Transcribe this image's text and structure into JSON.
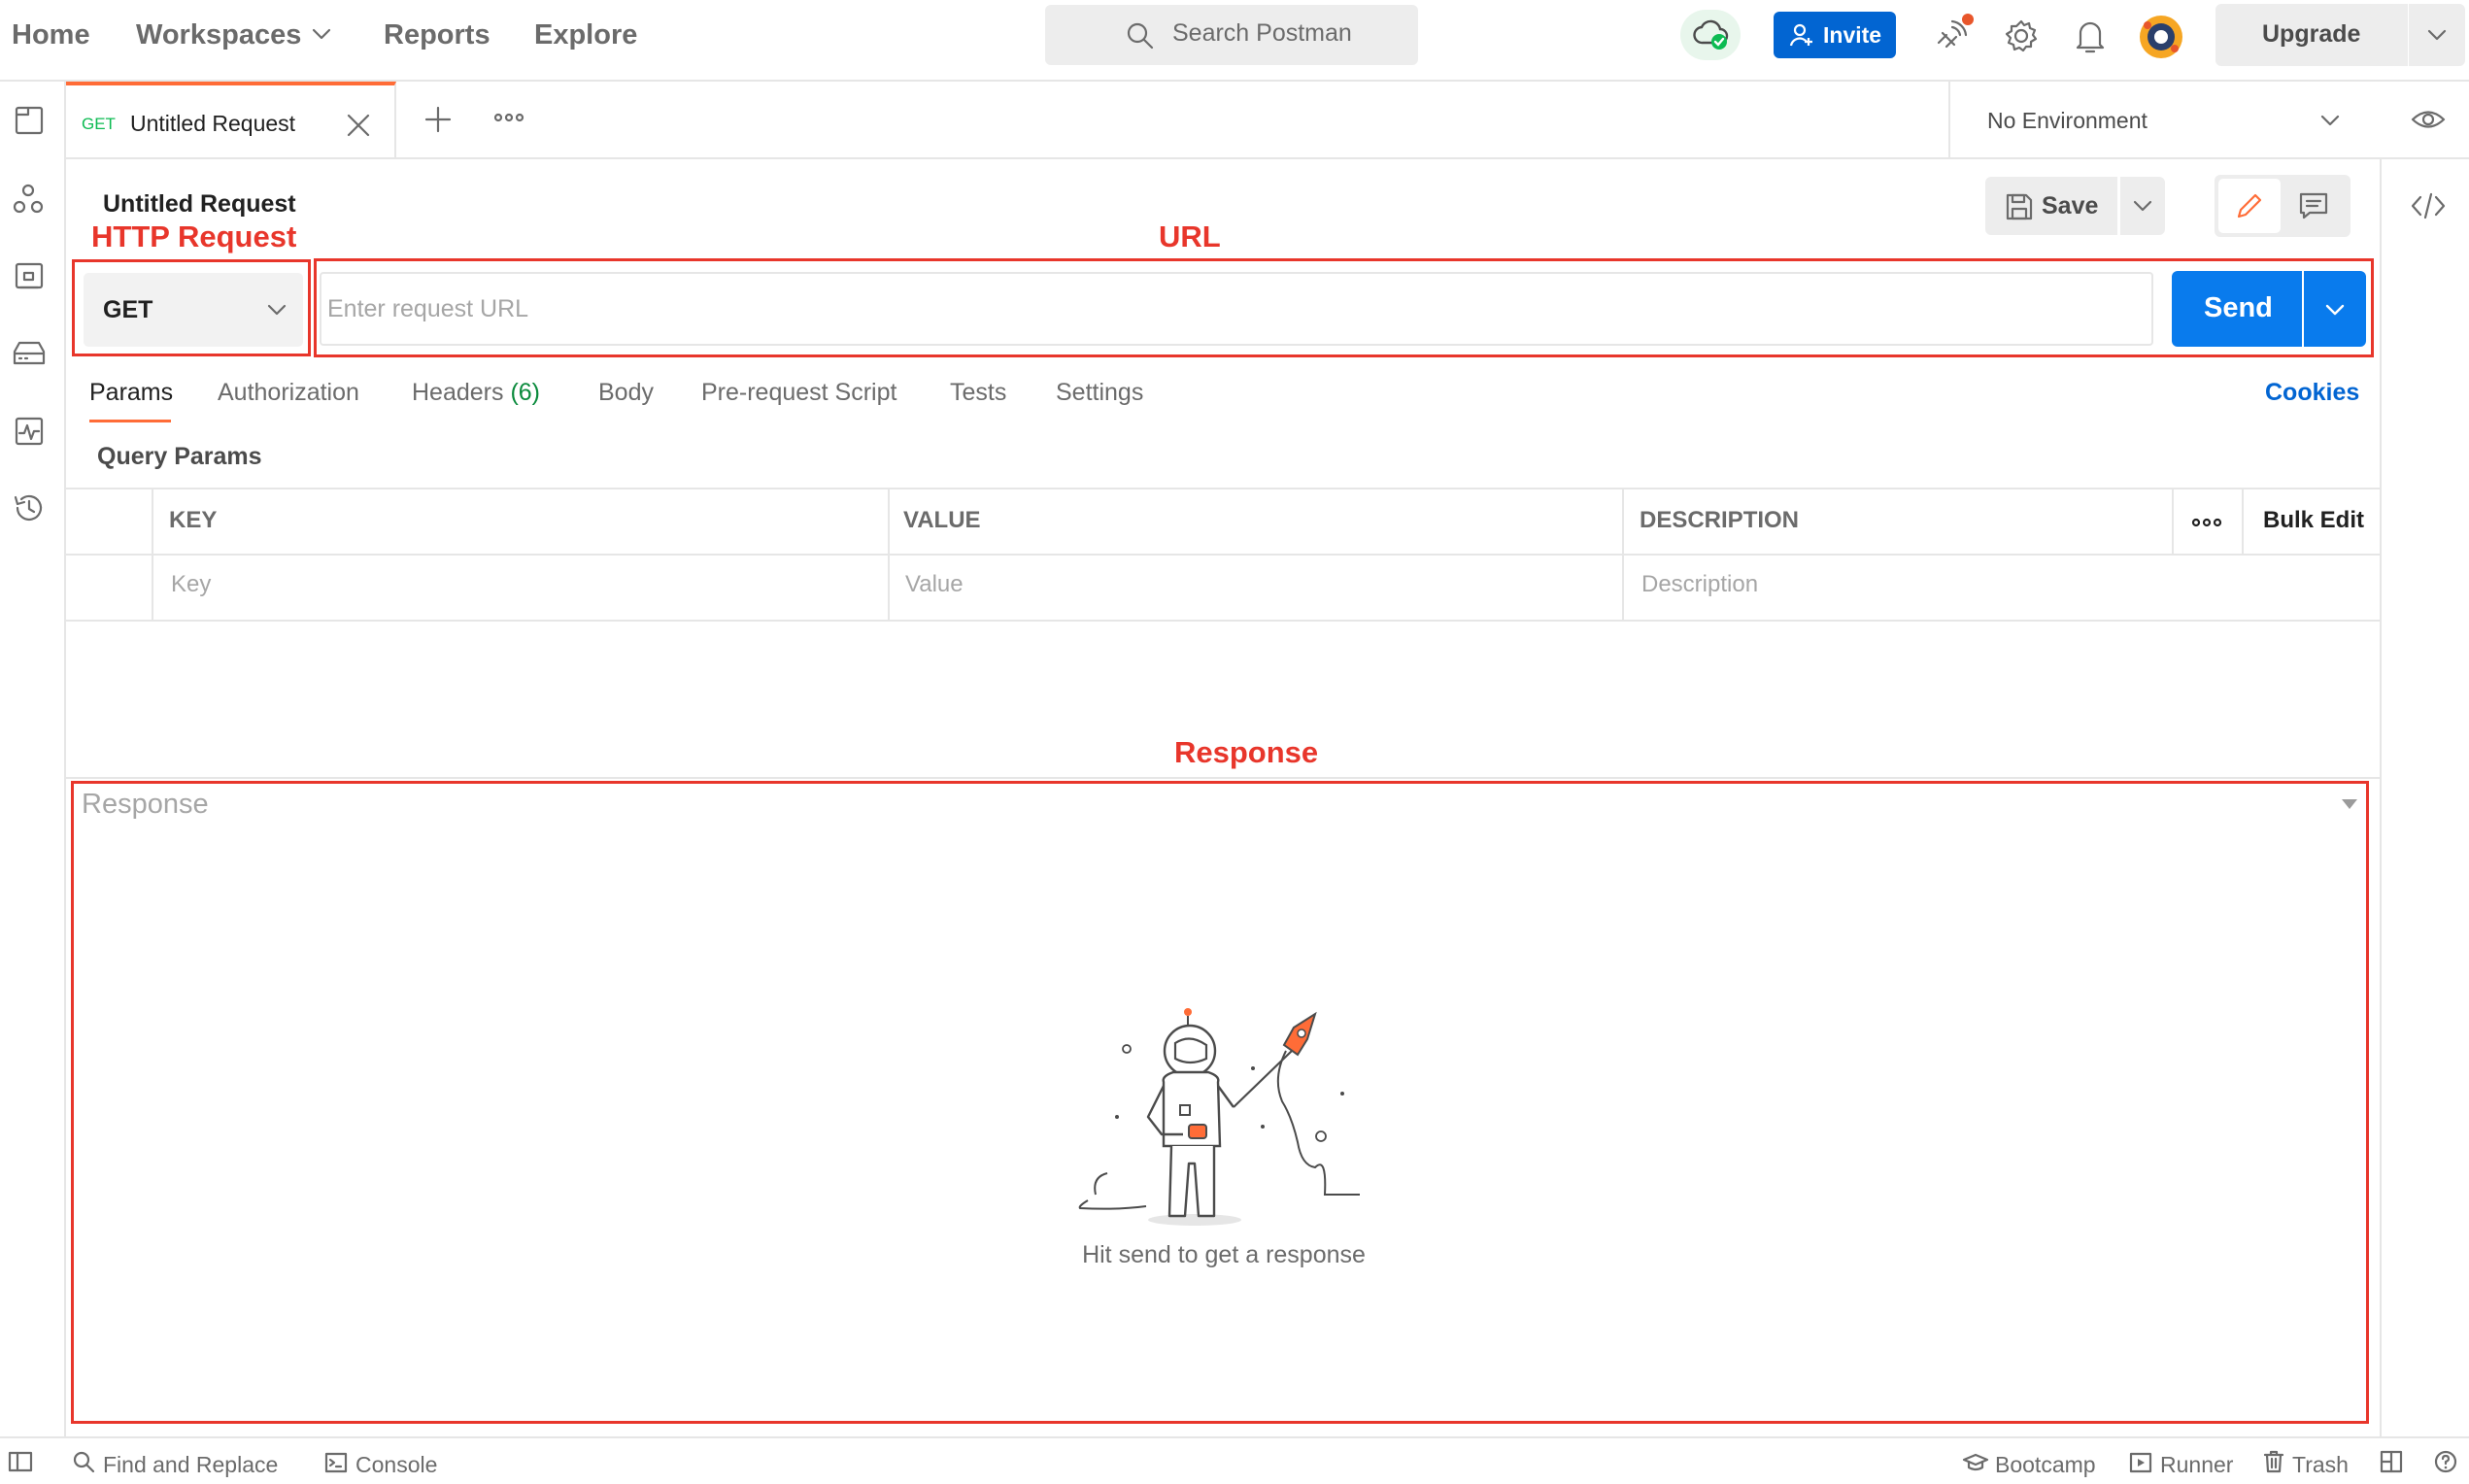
{
  "topnav": {
    "home": "Home",
    "workspaces": "Workspaces",
    "reports": "Reports",
    "explore": "Explore",
    "search_placeholder": "Search Postman",
    "invite": "Invite",
    "upgrade": "Upgrade"
  },
  "tabs": {
    "active": {
      "method": "GET",
      "name": "Untitled Request"
    }
  },
  "environment": {
    "selected": "No Environment"
  },
  "request": {
    "title": "Untitled Request",
    "save": "Save",
    "method": "GET",
    "url_value": "",
    "url_placeholder": "Enter request URL",
    "send": "Send"
  },
  "annotations": {
    "http_request": "HTTP Request",
    "url": "URL",
    "response": "Response"
  },
  "subtabs": {
    "params": "Params",
    "authorization": "Authorization",
    "headers": "Headers",
    "headers_count": "(6)",
    "body": "Body",
    "pre_request": "Pre-request Script",
    "tests": "Tests",
    "settings": "Settings",
    "cookies": "Cookies"
  },
  "query_params": {
    "label": "Query Params",
    "columns": [
      "KEY",
      "VALUE",
      "DESCRIPTION"
    ],
    "bulk_edit": "Bulk Edit",
    "placeholders": [
      "Key",
      "Value",
      "Description"
    ]
  },
  "response": {
    "label": "Response",
    "hint": "Hit send to get a response"
  },
  "statusbar": {
    "find_replace": "Find and Replace",
    "console": "Console",
    "bootcamp": "Bootcamp",
    "runner": "Runner",
    "trash": "Trash"
  },
  "colors": {
    "accent_orange": "#ff6c37",
    "send_blue": "#097bed",
    "invite_blue": "#0265d2",
    "annotation_red": "#e8362b",
    "method_green": "#0cbb52"
  }
}
